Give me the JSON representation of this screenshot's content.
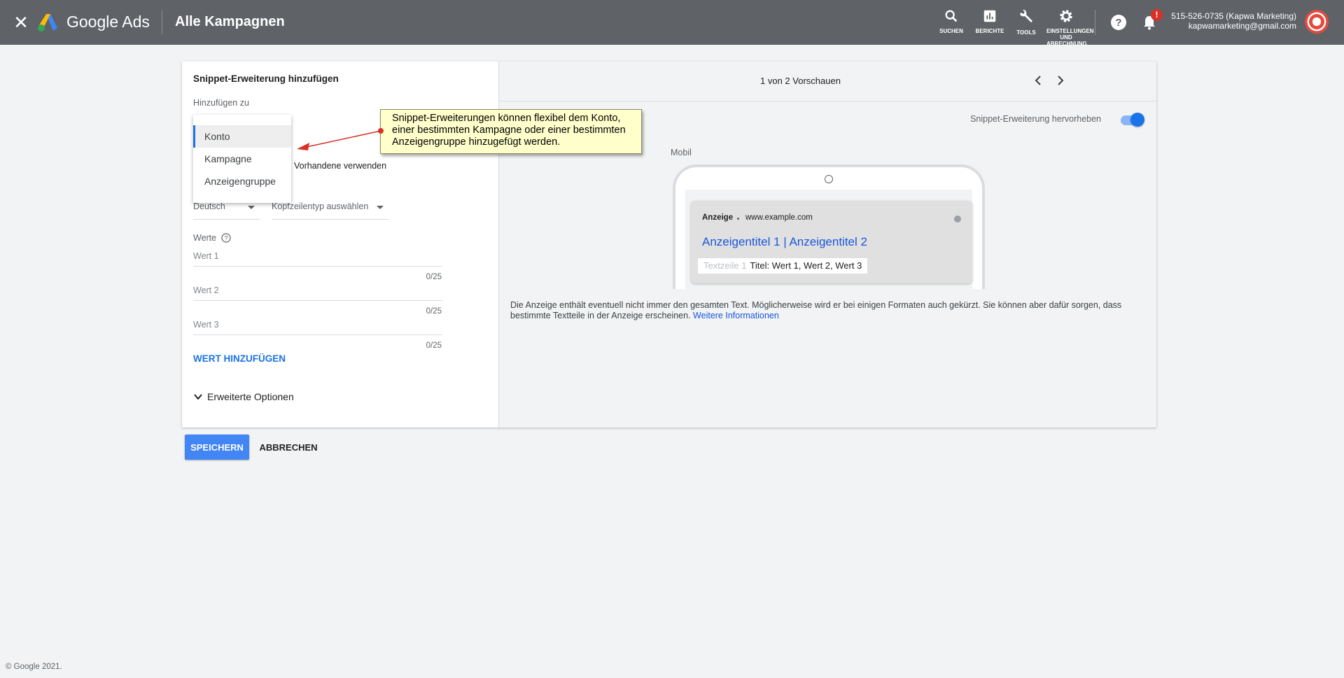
{
  "topbar": {
    "brand": "Google Ads",
    "page_title": "Alle Kampagnen",
    "tools": [
      {
        "label": "SUCHEN",
        "icon": "search-icon"
      },
      {
        "label": "BERICHTE",
        "icon": "reports-icon"
      },
      {
        "label": "TOOLS",
        "icon": "wrench-icon"
      },
      {
        "label": "EINSTELLUNGEN UND ABRECHNUNG",
        "icon": "gear-icon"
      }
    ],
    "notification_badge": "!",
    "account_name": "515-526-0735 (Kapwa Marketing)",
    "account_email": "kapwamarketing@gmail.com"
  },
  "form": {
    "title": "Snippet-Erweiterung hinzufügen",
    "add_to_label": "Hinzufügen zu",
    "dropdown_options": [
      "Konto",
      "Kampagne",
      "Anzeigengruppe"
    ],
    "selected_option": "Konto",
    "use_existing": "Vorhandene verwenden",
    "language": "Deutsch",
    "header_type_placeholder": "Kopfzeilentyp auswählen",
    "values_label": "Werte",
    "values": [
      {
        "placeholder": "Wert 1",
        "counter": "0/25"
      },
      {
        "placeholder": "Wert 2",
        "counter": "0/25"
      },
      {
        "placeholder": "Wert 3",
        "counter": "0/25"
      }
    ],
    "add_value": "WERT HINZUFÜGEN",
    "advanced_options": "Erweiterte Optionen"
  },
  "preview": {
    "pager": "1 von 2 Vorschauen",
    "highlight_label": "Snippet-Erweiterung hervorheben",
    "highlight_on": true,
    "device_label": "Mobil",
    "ad": {
      "badge": "Anzeige",
      "url": "www.example.com",
      "title": "Anzeigentitel 1 | Anzeigentitel 2",
      "snippet_faded": "Textzeile 1",
      "snippet_value": "Titel: Wert 1, Wert 2, Wert 3"
    },
    "disclaimer": "Die Anzeige enthält eventuell nicht immer den gesamten Text. Möglicherweise wird er bei einigen Formaten auch gekürzt. Sie können aber dafür sorgen, dass bestimmte Textteile in der Anzeige erscheinen.",
    "more_info_link": "Weitere Informationen"
  },
  "actions": {
    "save": "SPEICHERN",
    "cancel": "ABBRECHEN"
  },
  "footer": "© Google 2021.",
  "callout": {
    "text": "Snippet-Erweiterungen können flexibel dem Konto, einer bestimmten Kampagne oder einer bestimmten Anzeigengruppe hinzugefügt werden."
  },
  "colors": {
    "topbar": "#5f6368",
    "accent": "#1a73e8",
    "save_button": "#4285f4",
    "callout_bg": "#ffffcc",
    "arrow": "#d93025"
  }
}
